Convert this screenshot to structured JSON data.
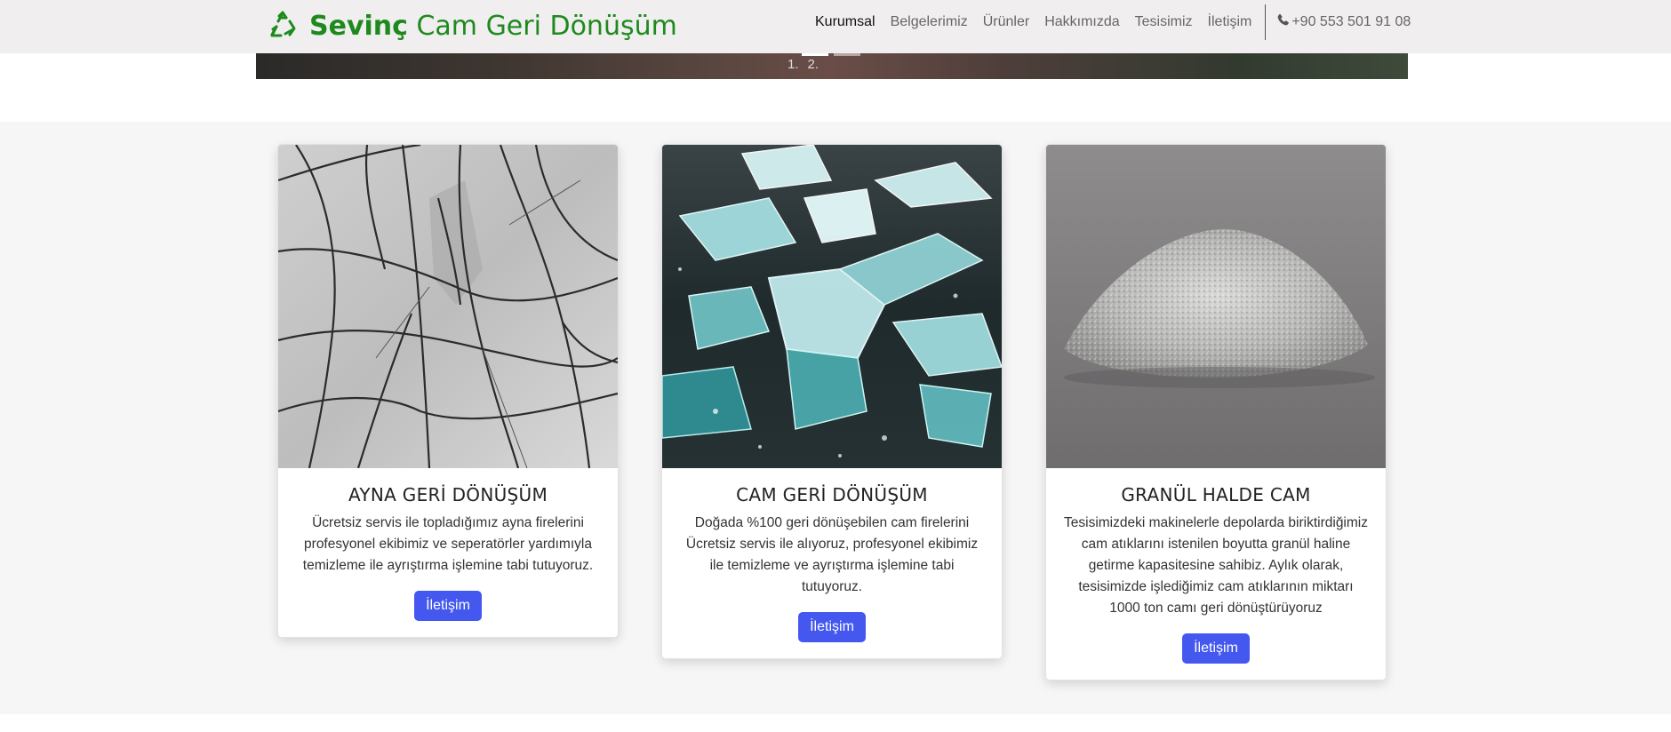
{
  "navbar": {
    "brand_bold": "Sevinç",
    "brand_rest": " Cam Geri Dönüşüm",
    "brand_icon": "recycle-icon",
    "items": [
      {
        "label": "Kurumsal",
        "active": true
      },
      {
        "label": "Belgelerimiz",
        "active": false
      },
      {
        "label": "Ürünler",
        "active": false
      },
      {
        "label": "Hakkımızda",
        "active": false
      },
      {
        "label": "Tesisimiz",
        "active": false
      },
      {
        "label": "İletişim",
        "active": false
      }
    ],
    "phone": "+90 553 501 91 08",
    "phone_icon": "phone-icon"
  },
  "carousel": {
    "indicators": [
      "1.",
      "2."
    ],
    "active_index": 0
  },
  "cards": [
    {
      "title": "AYNA GERİ DÖNÜŞÜM",
      "text": "Ücretsiz servis ile topladığımız ayna firelerini profesyonel ekibimiz ve seperatörler yardımıyla temizleme ile ayrıştırma işlemine tabi tutuyoruz.",
      "button": "İletişim",
      "image": "cracked-mirror-image"
    },
    {
      "title": "CAM GERİ DÖNÜŞÜM",
      "text": "Doğada %100 geri dönüşebilen cam firelerini Ücretsiz servis ile alıyoruz, profesyonel ekibimiz ile temizleme ve ayrıştırma işlemine tabi tutuyoruz.",
      "button": "İletişim",
      "image": "broken-glass-shards-image"
    },
    {
      "title": "GRANÜL HALDE CAM",
      "text": "Tesisimizdeki makinelerle depolarda biriktirdiğimiz cam atıklarını istenilen boyutta granül haline getirme kapasitesine sahibiz. Aylık olarak, tesisimizde işlediğimiz cam atıklarının miktarı 1000 ton camı geri dönüştürüyoruz",
      "button": "İletişim",
      "image": "granular-glass-pile-image"
    }
  ],
  "colors": {
    "brand_green": "#1e8a1e",
    "button_blue": "#4458f0",
    "navbar_bg": "#f0eeef",
    "section_bg": "#f6f6f6"
  }
}
